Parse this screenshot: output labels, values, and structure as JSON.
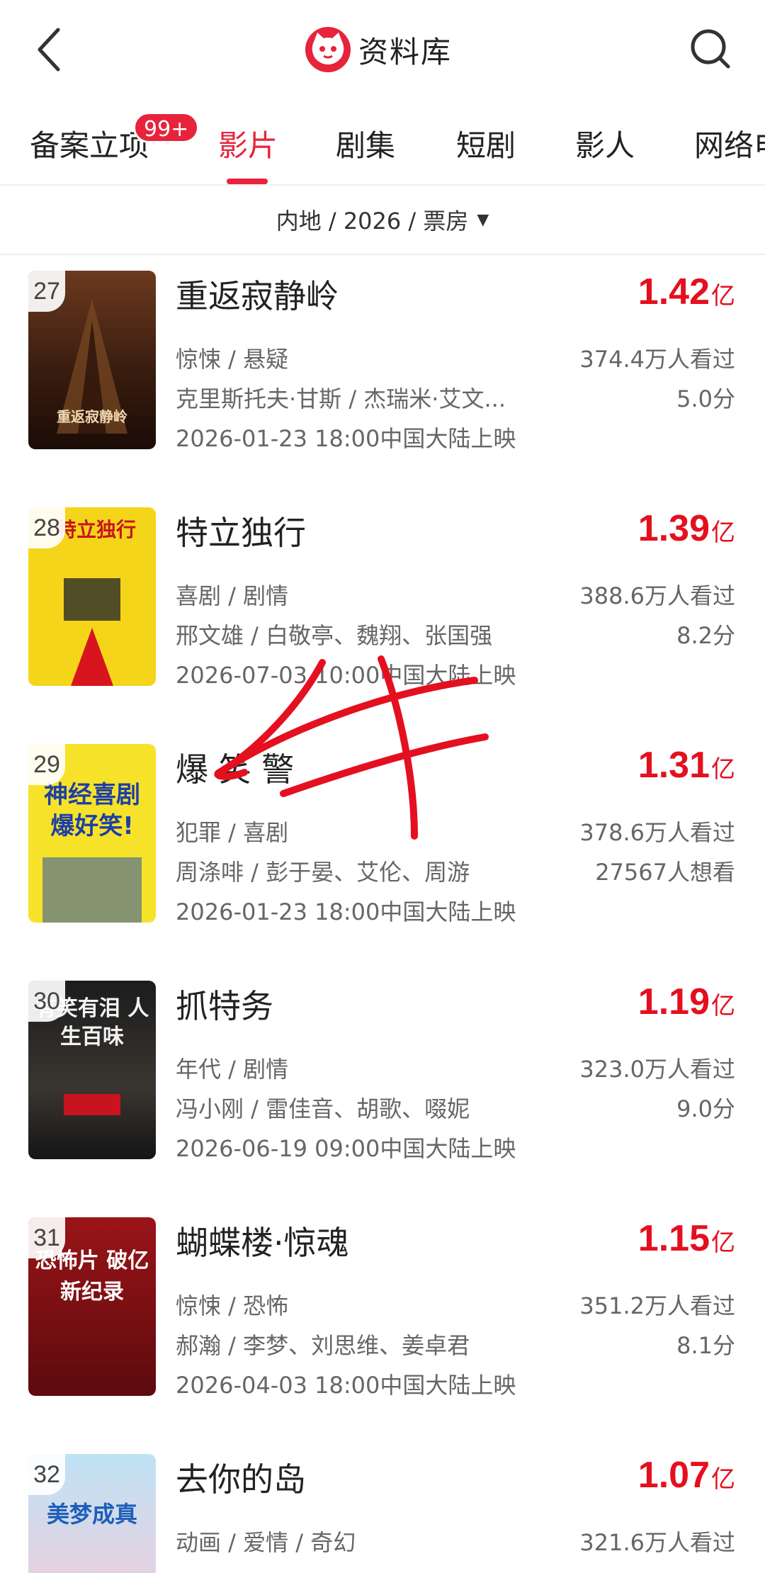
{
  "header": {
    "title": "资料库"
  },
  "tabs": [
    {
      "label": "备案立项"
    },
    {
      "label": "影片"
    },
    {
      "label": "剧集"
    },
    {
      "label": "短剧"
    },
    {
      "label": "影人"
    },
    {
      "label": "网络电"
    }
  ],
  "badge": "99+",
  "filter": {
    "label": "内地 / 2026 / 票房"
  },
  "colors": {
    "accent": "#e8233c",
    "gross": "#e4101f"
  },
  "movies": [
    {
      "rank": "27",
      "title": "重返寂静岭",
      "gross": "1.42",
      "unit": "亿",
      "genre": "惊悚 / 悬疑",
      "viewers": "374.4万人看过",
      "cast": "克里斯托夫·甘斯 / 杰瑞米·艾文...",
      "score": "5.0分",
      "release": "2026-01-23 18:00中国大陆上映",
      "poster_text": "重返寂静岭"
    },
    {
      "rank": "28",
      "title": "特立独行",
      "gross": "1.39",
      "unit": "亿",
      "genre": "喜剧 / 剧情",
      "viewers": "388.6万人看过",
      "cast": "邢文雄 / 白敬亭、魏翔、张国强",
      "score": "8.2分",
      "release": "2026-07-03 10:00中国大陆上映",
      "poster_text": "特立独行"
    },
    {
      "rank": "29",
      "title": "爆 笑 警",
      "gross": "1.31",
      "unit": "亿",
      "genre": "犯罪 / 喜剧",
      "viewers": "378.6万人看过",
      "cast": "周涤啡 / 彭于晏、艾伦、周游",
      "score": "27567人想看",
      "release": "2026-01-23 18:00中国大陆上映",
      "poster_text": "神经喜剧 爆好笑!"
    },
    {
      "rank": "30",
      "title": "抓特务",
      "gross": "1.19",
      "unit": "亿",
      "genre": "年代 / 剧情",
      "viewers": "323.0万人看过",
      "cast": "冯小刚 / 雷佳音、胡歌、啜妮",
      "score": "9.0分",
      "release": "2026-06-19 09:00中国大陆上映",
      "poster_text": "有笑有泪 人生百味"
    },
    {
      "rank": "31",
      "title": "蝴蝶楼·惊魂",
      "gross": "1.15",
      "unit": "亿",
      "genre": "惊悚 / 恐怖",
      "viewers": "351.2万人看过",
      "cast": "郝瀚 / 李梦、刘思维、姜卓君",
      "score": "8.1分",
      "release": "2026-04-03 18:00中国大陆上映",
      "poster_text": "恐怖片 破亿新纪录"
    },
    {
      "rank": "32",
      "title": "去你的岛",
      "gross": "1.07",
      "unit": "亿",
      "genre": "动画 / 爱情 / 奇幻",
      "viewers": "321.6万人看过",
      "cast": "",
      "score": "",
      "release": "",
      "poster_text": "美梦成真"
    }
  ]
}
